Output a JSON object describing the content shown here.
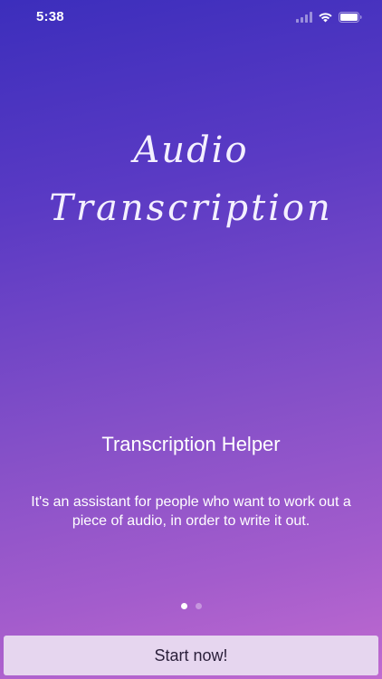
{
  "status_bar": {
    "time": "5:38",
    "icons": [
      "cellular-signal-icon",
      "wifi-icon",
      "battery-icon"
    ]
  },
  "intro": {
    "title_line1": "Audio",
    "title_line2": "Transcription",
    "headline": "Transcription Helper",
    "description": "It's an assistant for people who want to work out a piece of audio, in order to write it out.",
    "pages": {
      "count": 2,
      "active": 1
    }
  },
  "actions": {
    "start_label": "Start now!"
  },
  "colors": {
    "gradient_top": "#3c2ebc",
    "gradient_bottom": "#c06ad0",
    "button_bg": "#e6d6ef",
    "button_text": "#2a1f3a"
  }
}
